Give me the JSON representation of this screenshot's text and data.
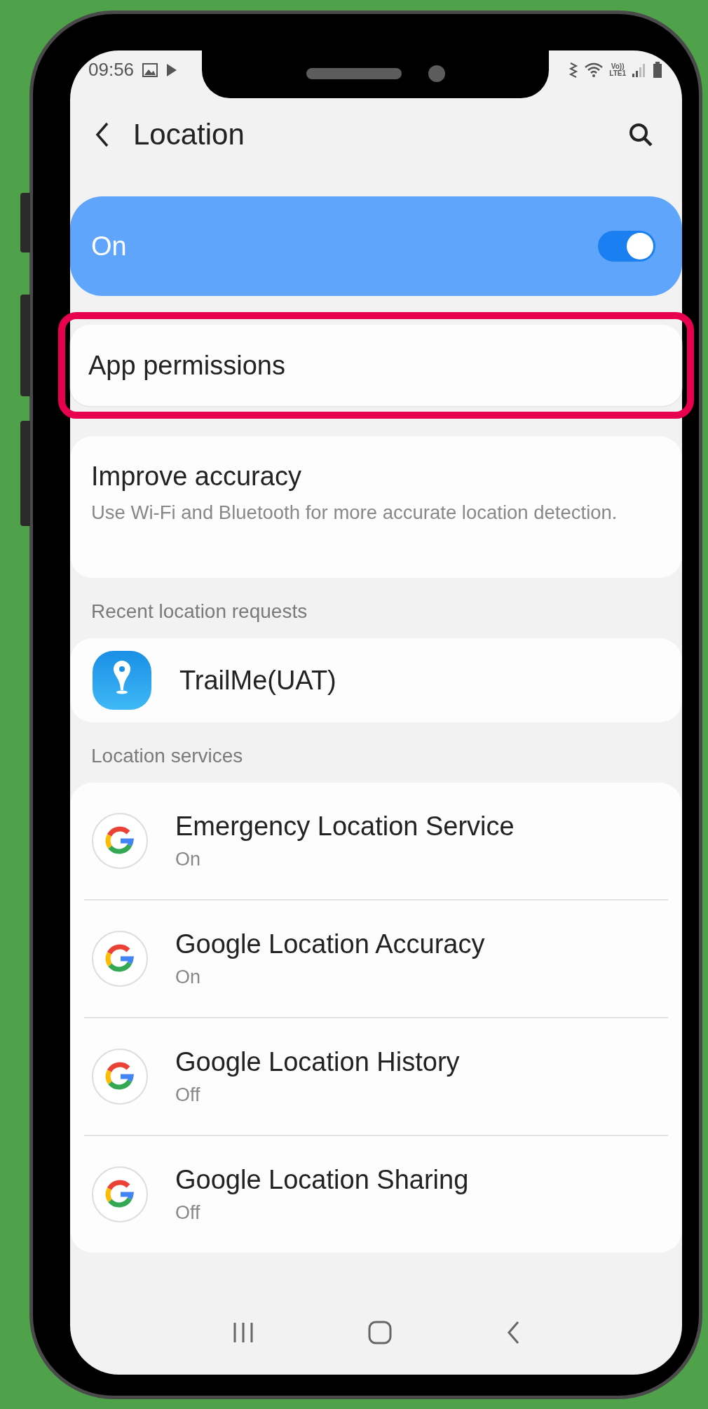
{
  "status_bar": {
    "time": "09:56",
    "network_label": "Vo))",
    "network_type": "LTE1"
  },
  "header": {
    "title": "Location"
  },
  "master_switch": {
    "label": "On",
    "on": true
  },
  "app_permissions": {
    "label": "App permissions",
    "highlighted": true
  },
  "improve_accuracy": {
    "title": "Improve accuracy",
    "subtitle": "Use Wi-Fi and Bluetooth for more accurate location detection."
  },
  "recent_requests": {
    "heading": "Recent location requests",
    "apps": [
      {
        "name": "TrailMe(UAT)"
      }
    ]
  },
  "location_services": {
    "heading": "Location services",
    "items": [
      {
        "title": "Emergency Location Service",
        "status": "On"
      },
      {
        "title": "Google Location Accuracy",
        "status": "On"
      },
      {
        "title": "Google Location History",
        "status": "Off"
      },
      {
        "title": "Google Location Sharing",
        "status": "Off"
      }
    ]
  }
}
